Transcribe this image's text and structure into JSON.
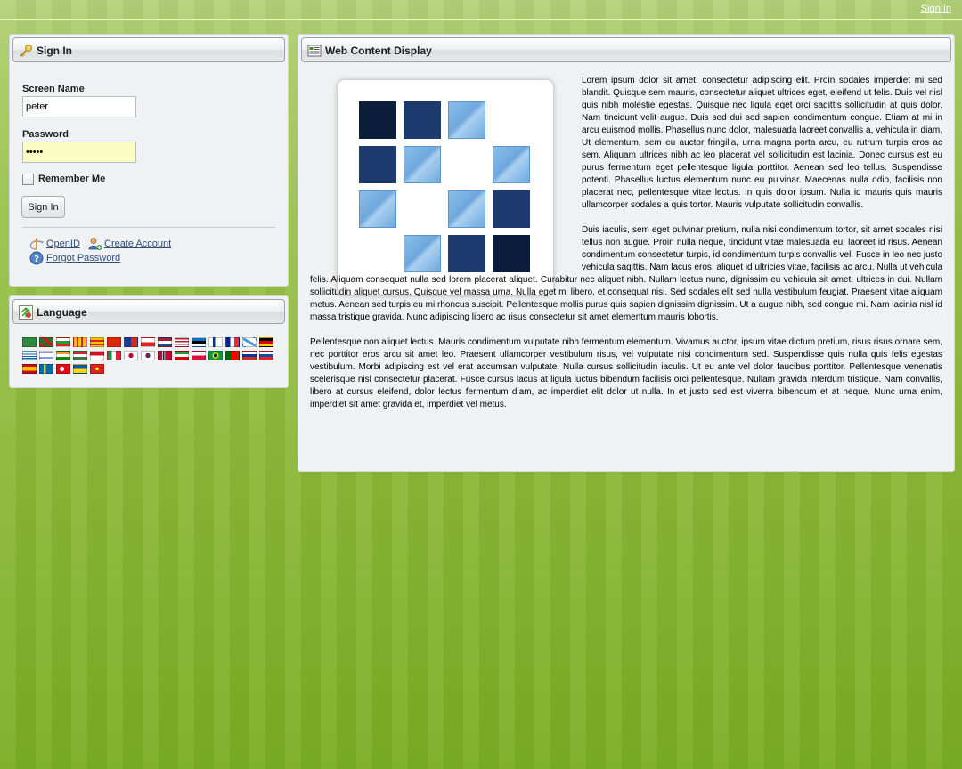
{
  "topbar": {
    "sign_in_link": "Sign In"
  },
  "signin_portlet": {
    "title": "Sign In",
    "screen_name_label": "Screen Name",
    "screen_name_value": "peter",
    "password_label": "Password",
    "password_value": "•••••",
    "remember_me_label": "Remember Me",
    "sign_in_button": "Sign In",
    "links": {
      "openid": "OpenID",
      "create_account": "Create Account",
      "forgot_password": "Forgot Password"
    }
  },
  "language_portlet": {
    "title": "Language",
    "flag_count": 29
  },
  "webcontent_portlet": {
    "title": "Web Content Display",
    "paragraphs": [
      "Lorem ipsum dolor sit amet, consectetur adipiscing elit. Proin sodales imperdiet mi sed blandit. Quisque sem mauris, consectetur aliquet ultrices eget, eleifend ut felis. Duis vel nisl quis nibh molestie egestas. Quisque nec ligula eget orci sagittis sollicitudin at quis dolor. Nam tincidunt velit augue. Duis sed dui sed sapien condimentum congue. Etiam at mi in arcu euismod mollis. Phasellus nunc dolor, malesuada laoreet convallis a, vehicula in diam. Ut elementum, sem eu auctor fringilla, urna magna porta arcu, eu rutrum turpis eros ac sem. Aliquam ultrices nibh ac leo placerat vel sollicitudin est lacinia. Donec cursus est eu purus fermentum eget pellentesque ligula porttitor. Aenean sed leo tellus. Suspendisse potenti. Phasellus luctus elementum nunc eu pulvinar. Maecenas nulla odio, facilisis non placerat nec, pellentesque vitae lectus. In quis dolor ipsum. Nulla id mauris quis mauris ullamcorper sodales a quis tortor. Mauris vulputate sollicitudin convallis.",
      "Duis iaculis, sem eget pulvinar pretium, nulla nisi condimentum tortor, sit amet sodales nisi tellus non augue. Proin nulla neque, tincidunt vitae malesuada eu, laoreet id risus. Aenean condimentum consectetur turpis, id condimentum turpis convallis vel. Fusce in leo nec justo vehicula sagittis. Nam lacus eros, aliquet id ultricies vitae, facilisis ac arcu. Nulla ut vehicula felis. Aliquam consequat nulla sed lorem placerat aliquet. Curabitur nec aliquet nibh. Nullam lectus nunc, dignissim eu vehicula sit amet, ultrices in dui. Nullam sollicitudin aliquet cursus. Quisque vel massa urna. Nulla eget mi libero, et consequat nisi. Sed sodales elit sed nulla vestibulum feugiat. Praesent vitae aliquam metus. Aenean sed turpis eu mi rhoncus suscipit. Pellentesque mollis purus quis sapien dignissim dignissim. Ut a augue nibh, sed congue mi. Nam lacinia nisl id massa tristique gravida. Nunc adipiscing libero ac risus consectetur sit amet elementum mauris lobortis.",
      "Pellentesque non aliquet lectus. Mauris condimentum vulputate nibh fermentum elementum. Vivamus auctor, ipsum vitae dictum pretium, risus risus ornare sem, nec porttitor eros arcu sit amet leo. Praesent ullamcorper vestibulum risus, vel vulputate nisi condimentum sed. Suspendisse quis nulla quis felis egestas vestibulum. Morbi adipiscing est vel erat accumsan vulputate. Nulla cursus sollicitudin iaculis. Ut eu ante vel dolor faucibus porttitor. Pellentesque venenatis scelerisque nisl consectetur placerat. Fusce cursus lacus at ligula luctus bibendum facilisis orci pellentesque. Nullam gravida interdum tristique. Nam convallis, libero at cursus eleifend, dolor lectus fermentum diam, ac imperdiet elit dolor ut nulla. In et justo sed est viverra bibendum et at neque. Nunc urna enim, imperdiet sit amet gravida et, imperdiet vel metus."
    ]
  },
  "colors": {
    "background_green": "#9bc24f",
    "link_blue": "#2e4e7c",
    "logo_dark": "#0b1d3a",
    "logo_mid": "#1d3a6e",
    "logo_light": "#7fb3e3"
  }
}
